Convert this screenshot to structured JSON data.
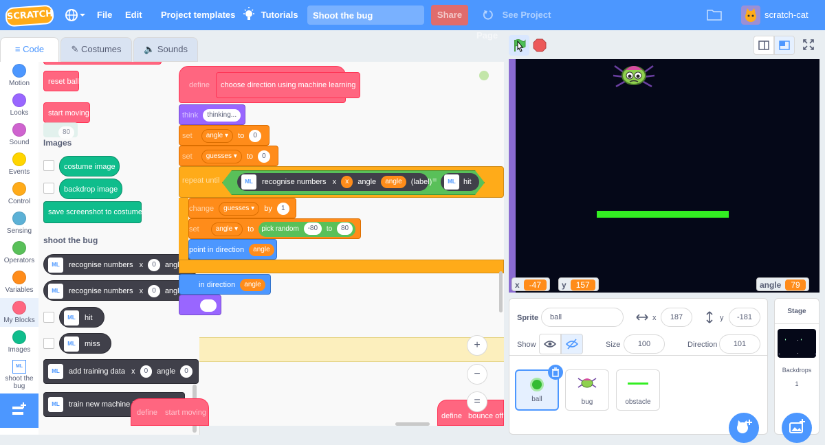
{
  "menu": {
    "logo": "SCRATCH",
    "file": "File",
    "edit": "Edit",
    "project_templates": "Project templates",
    "tutorials": "Tutorials",
    "project_title": "Shoot the bug",
    "share": "Share",
    "see_project_page": "See Project Page",
    "username": "scratch-cat"
  },
  "tabs": {
    "code": "Code",
    "costumes": "Costumes",
    "sounds": "Sounds"
  },
  "categories": [
    {
      "label": "Motion",
      "color": "#4c97ff"
    },
    {
      "label": "Looks",
      "color": "#9966ff"
    },
    {
      "label": "Sound",
      "color": "#cf63cf"
    },
    {
      "label": "Events",
      "color": "#ffd500"
    },
    {
      "label": "Control",
      "color": "#ffab19"
    },
    {
      "label": "Sensing",
      "color": "#5cb1d6"
    },
    {
      "label": "Operators",
      "color": "#59c059"
    },
    {
      "label": "Variables",
      "color": "#ff8c1a"
    },
    {
      "label": "My Blocks",
      "color": "#ff6680"
    },
    {
      "label": "Images",
      "color": "#0fbd8c"
    },
    {
      "label": "shoot the bug",
      "color": "#4c97ff"
    }
  ],
  "palette": {
    "reset_ball": "reset ball",
    "start_moving": "start moving",
    "partial_value": "80",
    "images_heading": "Images",
    "costume_image": "costume image",
    "backdrop_image": "backdrop image",
    "save_screenshot": "save screenshot to costume",
    "shoot_heading": "shoot the bug",
    "recognise_numbers": "recognise numbers",
    "x": "x",
    "zero": "0",
    "angle": "angle",
    "hit": "hit",
    "miss": "miss",
    "add_training_data": "add training data",
    "train_model": "train new machine learning model",
    "ml_icon": "ML"
  },
  "script": {
    "define": "define",
    "define_name": "choose direction using machine learning",
    "think": "think",
    "thinking": "thinking...",
    "set": "set",
    "angle_var": "angle",
    "to": "to",
    "zero": "0",
    "guesses_var": "guesses",
    "repeat_until": "repeat until",
    "recognise_numbers": "recognise numbers",
    "x": "x",
    "angle": "angle",
    "label": "(label)",
    "equals": "=",
    "hit": "hit",
    "change": "change",
    "by": "by",
    "one": "1",
    "pick_random": "pick random",
    "neg80": "-80",
    "pos80": "80",
    "point_in_direction": "point in direction",
    "in_direction": "in direction",
    "bottom_define": "define",
    "start_moving": "start moving",
    "bounce_define": "define",
    "bounce_off": "bounce off",
    "ml_icon": "ML"
  },
  "zoom": {
    "in": "+",
    "out": "−",
    "reset": "="
  },
  "stage": {
    "x_label": "x",
    "x_value": "-47",
    "y_label": "y",
    "y_value": "157",
    "angle_label": "angle",
    "angle_value": "79"
  },
  "sprite_info": {
    "sprite_label": "Sprite",
    "sprite_name": "ball",
    "x_label": "x",
    "x_value": "187",
    "y_label": "y",
    "y_value": "-181",
    "show_label": "Show",
    "size_label": "Size",
    "size_value": "100",
    "direction_label": "Direction",
    "direction_value": "101"
  },
  "sprites": [
    {
      "name": "ball"
    },
    {
      "name": "bug"
    },
    {
      "name": "obstacle"
    }
  ],
  "stage_pane": {
    "title": "Stage",
    "backdrops_label": "Backdrops",
    "backdrops_count": "1"
  },
  "colors": {
    "menu": "#4c97ff",
    "paddle": "#33ee22",
    "variable": "#ff8c1a",
    "my_blocks": "#ff6680",
    "images": "#0fbd8c",
    "ml": "#40404a"
  }
}
